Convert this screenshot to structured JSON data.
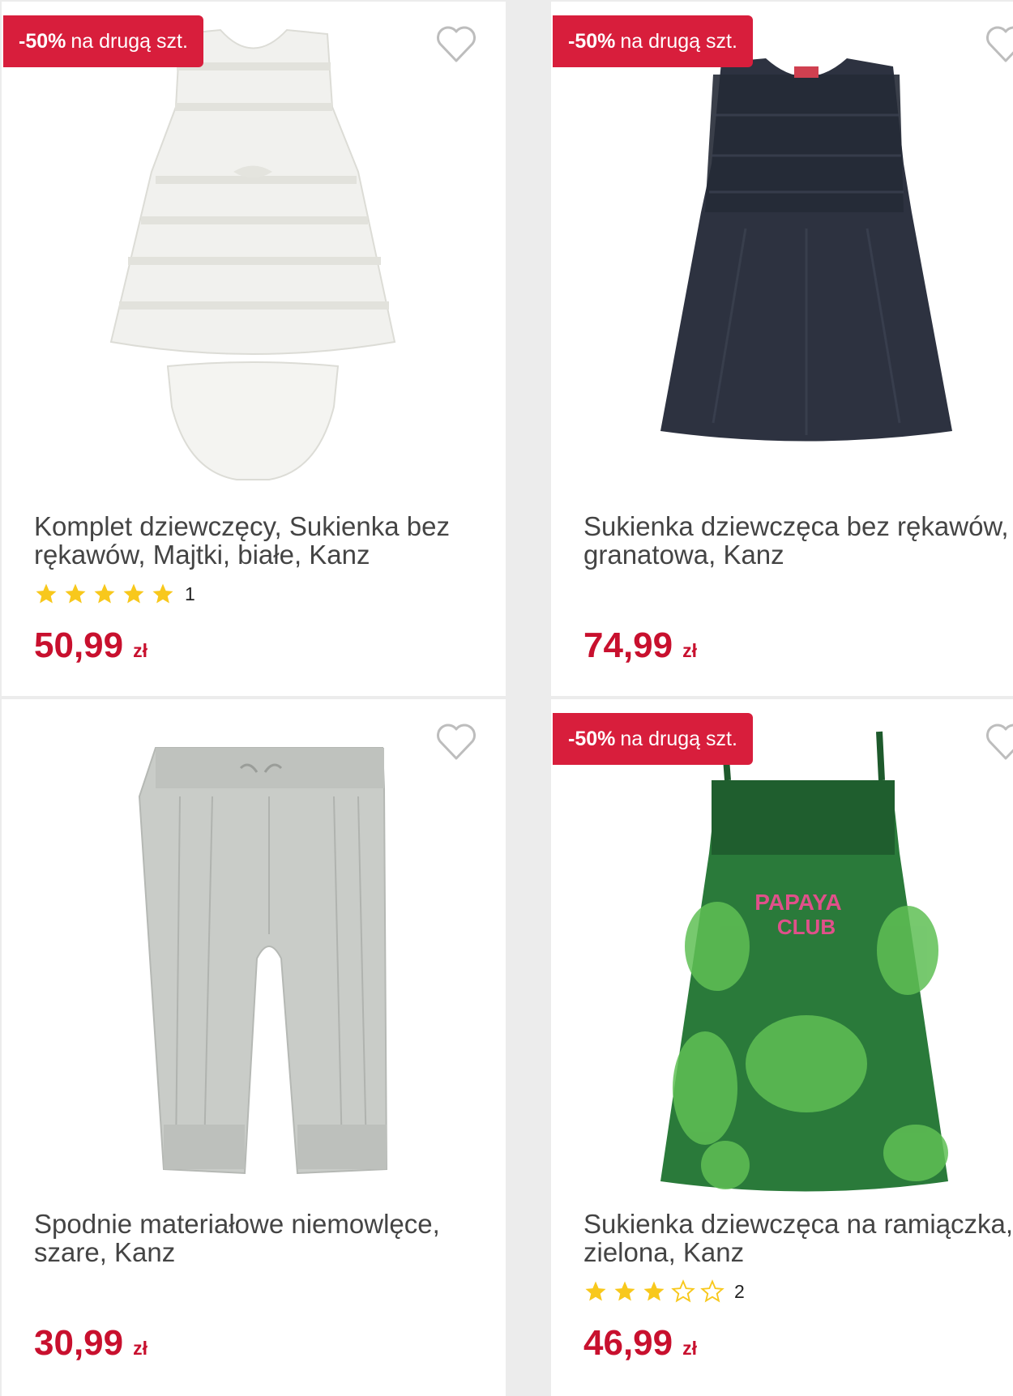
{
  "colors": {
    "accent": "#c8102e",
    "badge_bg": "#d81e3c",
    "star_fill": "#f8c81c",
    "background": "#ececec",
    "card": "#ffffff"
  },
  "products": [
    {
      "badge": {
        "percent": "-50%",
        "text": "na drugą szt."
      },
      "title": "Komplet dziewczęcy, Sukienka bez rękawów, Majtki, białe, Kanz",
      "rating": {
        "value": 5,
        "max": 5,
        "count": "1"
      },
      "price": {
        "amount": "50,99",
        "currency": "zł"
      },
      "image_icon": "white-dress-with-bloomers"
    },
    {
      "badge": {
        "percent": "-50%",
        "text": "na drugą szt."
      },
      "title": "Sukienka dziewczęca bez rękawów, granatowa, Kanz",
      "price": {
        "amount": "74,99",
        "currency": "zł"
      },
      "image_icon": "navy-tulle-dress"
    },
    {
      "title": "Spodnie materiałowe niemowlęce, szare, Kanz",
      "price": {
        "amount": "30,99",
        "currency": "zł"
      },
      "image_icon": "grey-baby-trousers"
    },
    {
      "badge": {
        "percent": "-50%",
        "text": "na drugą szt."
      },
      "title": "Sukienka dziewczęca na ramiączka, zielona, Kanz",
      "rating": {
        "value": 3,
        "max": 5,
        "count": "2"
      },
      "price": {
        "amount": "46,99",
        "currency": "zł"
      },
      "image_icon": "green-leaf-print-dress",
      "print_text": "PAPAYA CLUB"
    }
  ]
}
